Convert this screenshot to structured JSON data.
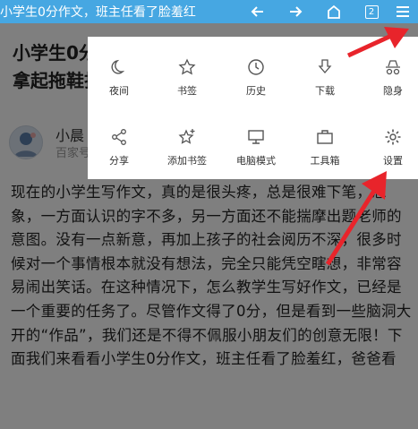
{
  "topbar": {
    "title": "小学生0分作文，班主任看了脸羞红",
    "tabs_count": "2",
    "icons": [
      "back-arrow-icon",
      "forward-arrow-icon",
      "home-icon",
      "tabs-icon",
      "menu-icon"
    ]
  },
  "article": {
    "headline": "小学生0分作文，班主任看了脸羞红，爸爸看了，拿起拖鞋打了6条街！",
    "author_name": "小晨",
    "author_sub": "百家号",
    "body": "现在的小学生写作文，真的是很头疼，总是很难下笔，想象，一方面认识的字不多，另一方面还不能揣摩出题老师的意图。没有一点新意，再加上孩子的社会阅历不深，很多时候对一个事情根本就没有想法，完全只能凭空瞎想，非常容易闹出笑话。在这种情况下，怎么教学生写好作文，已经是一个重要的任务了。尽管作文得了0分，但是看到一些脑洞大开的“作品”，我们还是不得不佩服小朋友们的创意无限！下面我们来看看小学生0分作文，班主任看了脸羞红，爸爸看"
  },
  "menu": {
    "row1": [
      {
        "label": "夜间",
        "icon": "moon-icon"
      },
      {
        "label": "书签",
        "icon": "star-icon"
      },
      {
        "label": "历史",
        "icon": "clock-icon"
      },
      {
        "label": "下载",
        "icon": "download-icon"
      },
      {
        "label": "隐身",
        "icon": "incognito-icon"
      }
    ],
    "row2": [
      {
        "label": "分享",
        "icon": "share-icon"
      },
      {
        "label": "添加书签",
        "icon": "add-bookmark-icon"
      },
      {
        "label": "电脑模式",
        "icon": "desktop-icon"
      },
      {
        "label": "工具箱",
        "icon": "toolbox-icon"
      },
      {
        "label": "设置",
        "icon": "settings-gear-icon"
      }
    ]
  },
  "colors": {
    "topbar": "#46a7e2",
    "overlay": "rgba(0,0,0,0.5)",
    "arrow": "#e8242b",
    "menu_bg": "#ffffff"
  }
}
